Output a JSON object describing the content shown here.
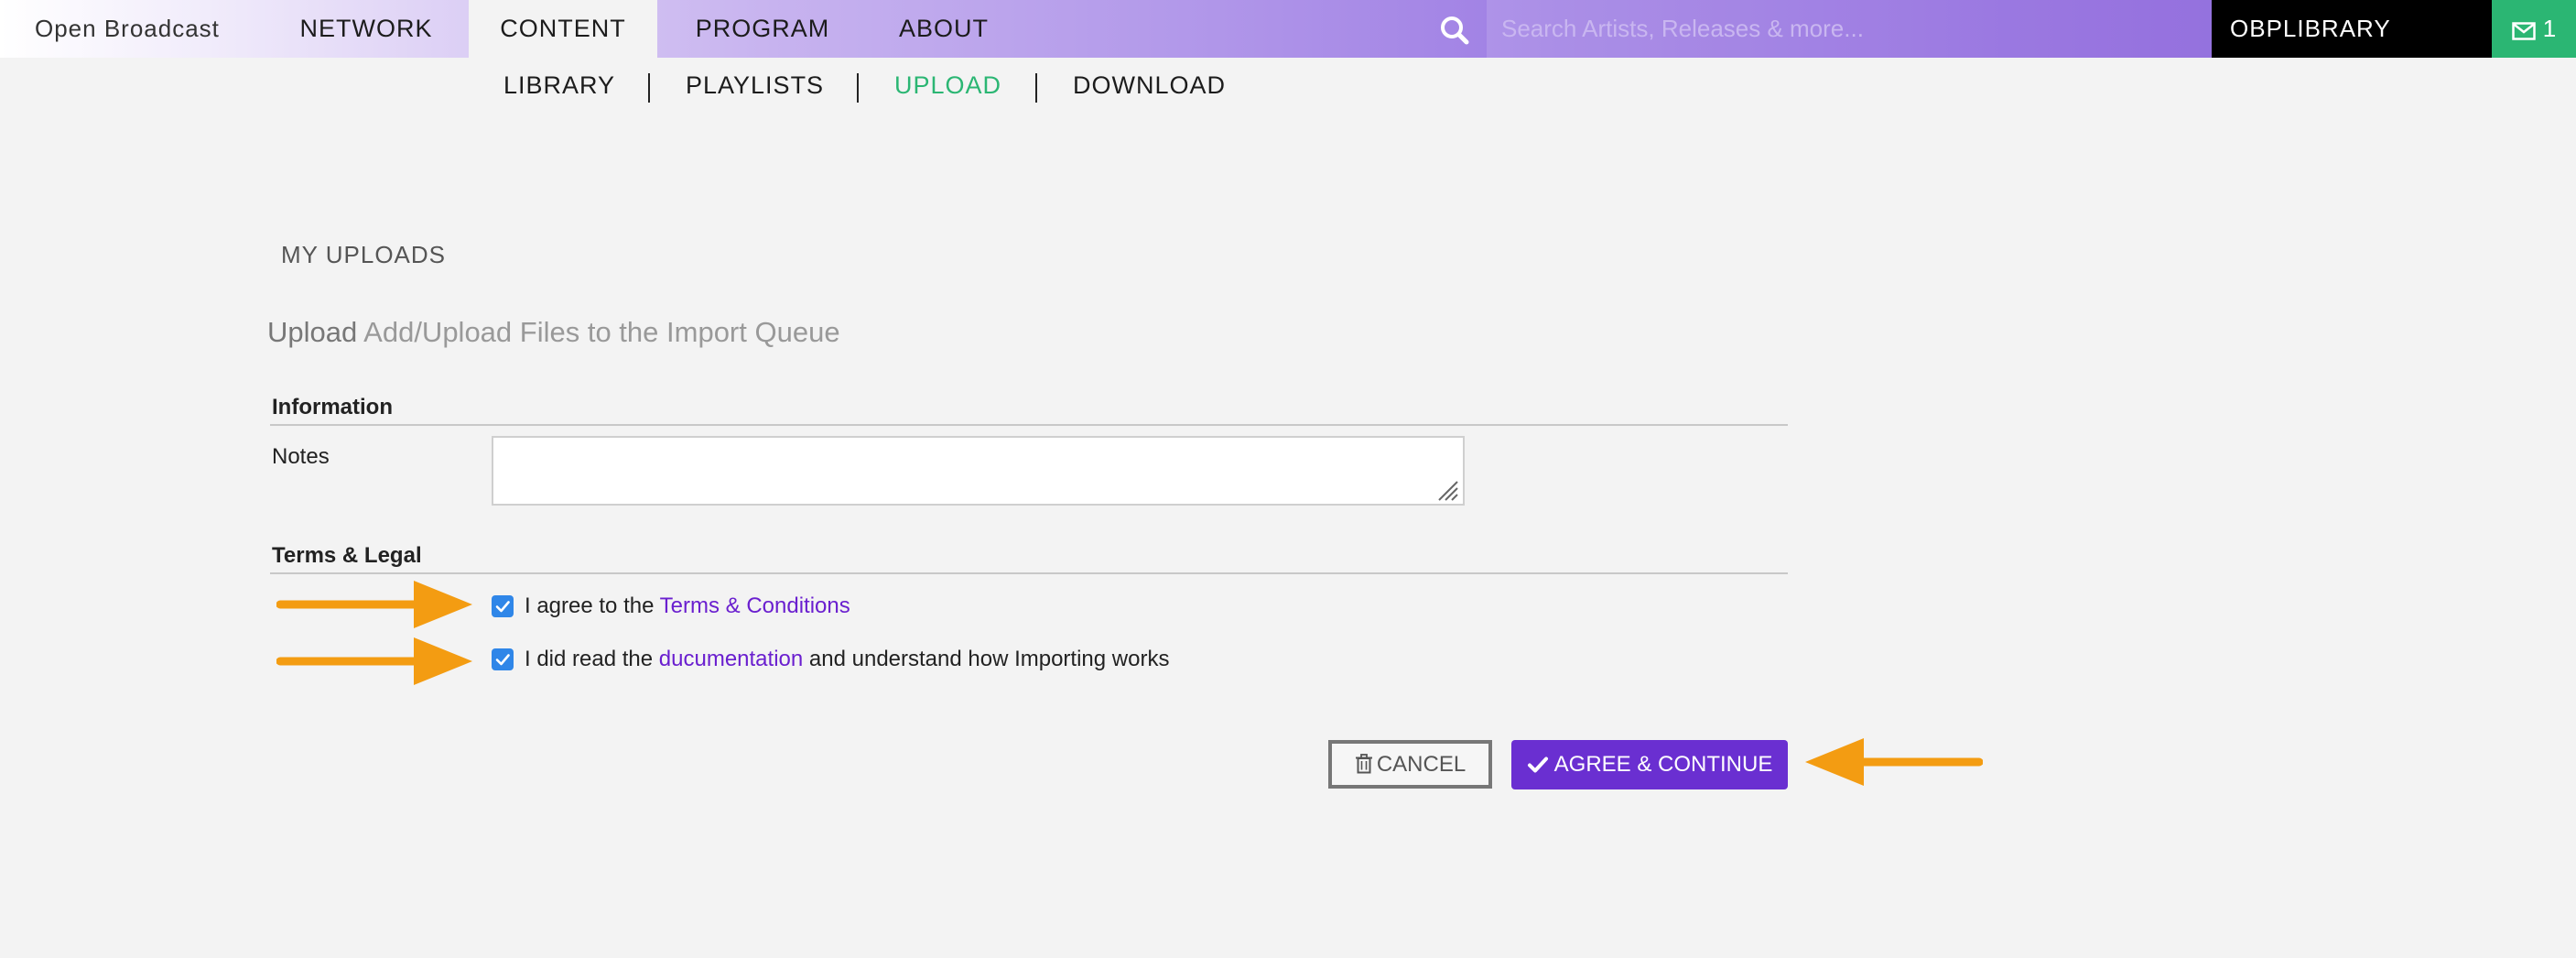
{
  "topnav": {
    "brand": "Open Broadcast",
    "items": [
      {
        "label": "NETWORK"
      },
      {
        "label": "CONTENT",
        "active": true
      },
      {
        "label": "PROGRAM"
      },
      {
        "label": "ABOUT"
      }
    ],
    "search_placeholder": "Search Artists, Releases & more...",
    "library_label": "OBPLIBRARY",
    "messages_count": "1",
    "search_icon": "search-icon",
    "messages_icon": "envelope-icon"
  },
  "subnav": {
    "items": [
      {
        "label": "LIBRARY"
      },
      {
        "label": "PLAYLISTS"
      },
      {
        "label": "UPLOAD",
        "active": true
      },
      {
        "label": "DOWNLOAD"
      }
    ]
  },
  "main": {
    "section_heading": "MY UPLOADS",
    "title": "Upload",
    "subtitle": "Add/Upload Files to the Import Queue",
    "information_legend": "Information",
    "notes_label": "Notes",
    "notes_value": "",
    "terms_legend": "Terms & Legal",
    "agree_terms": {
      "checked": true,
      "prefix": "I agree to the",
      "link": "Terms & Conditions"
    },
    "read_docs": {
      "checked": true,
      "prefix": "I did read the",
      "link": "ducumentation",
      "suffix": "and understand how Importing works"
    },
    "cancel_label": "CANCEL",
    "agree_label": "AGREE & CONTINUE"
  },
  "colors": {
    "accent_purple": "#6a2fd1",
    "active_green": "#2bb673",
    "checkbox_blue": "#2f86e8",
    "annotation_arrow": "#f39c12"
  }
}
